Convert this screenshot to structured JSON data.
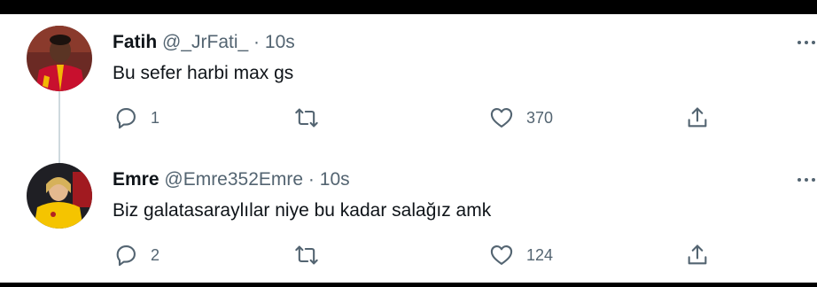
{
  "tweets": [
    {
      "name": "Fatih",
      "handle": "@_JrFati_",
      "separator": "·",
      "time": "10s",
      "text": "Bu sefer harbi max gs",
      "replies": "1",
      "likes": "370",
      "avatar": "player-in-red-yellow-jersey"
    },
    {
      "name": "Emre",
      "handle": "@Emre352Emre",
      "separator": "·",
      "time": "10s",
      "text": "Biz galatasaraylılar niye bu kadar salağız amk",
      "replies": "2",
      "likes": "124",
      "avatar": "person-in-yellow-jersey"
    }
  ],
  "icons": {
    "reply": "reply-icon",
    "retweet": "retweet-icon",
    "like": "like-icon",
    "share": "share-icon",
    "more": "more-icon"
  },
  "colors": {
    "text": "#0f1419",
    "secondary": "#536471",
    "background": "#ffffff",
    "frame": "#000000"
  }
}
